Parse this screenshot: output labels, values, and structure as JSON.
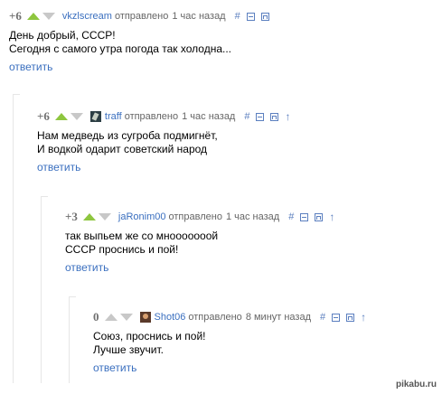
{
  "comments": [
    {
      "rating": "+6",
      "author": "vkzlscream",
      "sent": "отправлено",
      "time": "1 час назад",
      "text": [
        "День добрый, СССР!",
        "Сегодня с самого утра погода так холодна..."
      ],
      "reply": "ответить",
      "has_avatar": false
    },
    {
      "rating": "+6",
      "author": "traff",
      "sent": "отправлено",
      "time": "1 час назад",
      "text": [
        "Нам медведь из сугроба подмигнёт,",
        "И водкой одарит советский народ"
      ],
      "reply": "ответить",
      "has_avatar": true
    },
    {
      "rating": "+3",
      "author": "jaRonim00",
      "sent": "отправлено",
      "time": "1 час назад",
      "text": [
        "так выпьем же со мнооооооой",
        "СССР проснись и пой!"
      ],
      "reply": "ответить",
      "has_avatar": false
    },
    {
      "rating": "0",
      "author": "Shot06",
      "sent": "отправлено",
      "time": "8 минут назад",
      "text": [
        "Союз, проснись и пой!",
        "Лучше звучит."
      ],
      "reply": "ответить",
      "has_avatar": true
    }
  ],
  "tools": {
    "link": "#",
    "up": "↑"
  },
  "watermark": "pikabu.ru",
  "colors": {
    "upvote": "#8ec63f",
    "link": "#3a6fbf",
    "tool": "#5b7fbf"
  },
  "icons": [
    "upvote-arrow-icon",
    "downvote-arrow-icon",
    "collapse-icon",
    "save-icon",
    "parent-arrow-icon"
  ]
}
